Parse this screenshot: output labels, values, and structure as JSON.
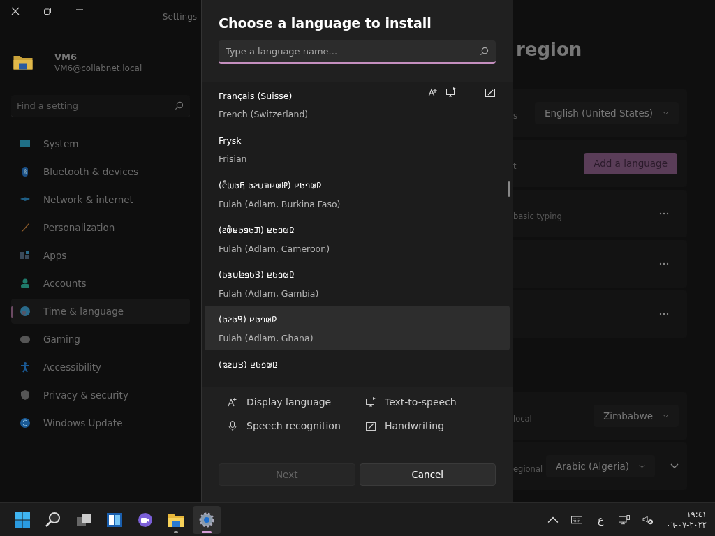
{
  "window": {
    "title": "Settings"
  },
  "account": {
    "name": "VM6",
    "email": "VM6@collabnet.local"
  },
  "sidebar": {
    "search": {
      "placeholder": "Find a setting"
    },
    "items": [
      {
        "label": "System",
        "kind": "system",
        "selected": false
      },
      {
        "label": "Bluetooth & devices",
        "kind": "bluetooth",
        "selected": false
      },
      {
        "label": "Network & internet",
        "kind": "network",
        "selected": false
      },
      {
        "label": "Personalization",
        "kind": "brush",
        "selected": false
      },
      {
        "label": "Apps",
        "kind": "apps",
        "selected": false
      },
      {
        "label": "Accounts",
        "kind": "person",
        "selected": false
      },
      {
        "label": "Time & language",
        "kind": "globe",
        "selected": true
      },
      {
        "label": "Gaming",
        "kind": "gamepad",
        "selected": false
      },
      {
        "label": "Accessibility",
        "kind": "accessibility",
        "selected": false
      },
      {
        "label": "Privacy & security",
        "kind": "shield",
        "selected": false
      },
      {
        "label": "Windows Update",
        "kind": "update",
        "selected": false
      }
    ]
  },
  "page": {
    "title": "region",
    "rows": [
      {
        "kind": "dropdown",
        "label": "s",
        "value": "English (United States)"
      },
      {
        "kind": "button",
        "label": "t",
        "value": "Add a language"
      },
      {
        "kind": "more",
        "label": "basic typing"
      },
      {
        "kind": "more"
      },
      {
        "kind": "more"
      },
      {
        "kind": "gap"
      },
      {
        "kind": "dropdown",
        "label": "local",
        "value": "Zimbabwe"
      },
      {
        "kind": "expander",
        "label": "egional",
        "value": "Arabic (Algeria)"
      }
    ]
  },
  "dialog": {
    "title": "Choose a language to install",
    "search": {
      "placeholder": "Type a language name..."
    },
    "languages": [
      {
        "native": "Français (Suisse)",
        "english": "French (Switzerland)",
        "hovered": false,
        "features": [
          {
            "kind": "display"
          },
          {
            "kind": "tts"
          },
          {
            "kind": "handwriting"
          }
        ]
      },
      {
        "native": "Frysk",
        "english": "Frisian",
        "hovered": false
      },
      {
        "native": "𞤆𞤵𞤤𞤢𞤪 (𞤄𞤵𞤪𞤳𞤭𞤲𞤢 𞤊𞤢𞤧𞤮𞥅)",
        "english": "Fulah (Adlam, Burkina Faso)",
        "hovered": false
      },
      {
        "native": "𞤆𞤵𞤤𞤢𞤪 (𞤑𞤢𞤥𞤢𞤪𞤵𞥅𞤲)",
        "english": "Fulah (Adlam, Cameroon)",
        "hovered": false
      },
      {
        "native": "𞤆𞤵𞤤𞤢𞤪 (𞤘𞤢𞤥𞤦𞤭𞤴𞤢)",
        "english": "Fulah (Adlam, Gambia)",
        "hovered": false
      },
      {
        "native": "𞤆𞤵𞤤𞤢𞤪 (𞤘𞤢𞤲𞤢)",
        "english": "Fulah (Adlam, Ghana)",
        "hovered": true
      },
      {
        "native": "𞤆𞤵𞤤𞤢𞤪 (𞤘𞤭𞤲𞤫)",
        "hovered": false
      }
    ],
    "legend": [
      {
        "kind": "display",
        "label": "Display language"
      },
      {
        "kind": "tts",
        "label": "Text-to-speech"
      },
      {
        "kind": "speech",
        "label": "Speech recognition"
      },
      {
        "kind": "handwriting",
        "label": "Handwriting"
      }
    ],
    "buttons": [
      {
        "label": "Next",
        "disabled": true
      },
      {
        "label": "Cancel",
        "disabled": false
      }
    ]
  },
  "taskbar": {
    "apps": [
      {
        "kind": "start",
        "active": false,
        "running": false
      },
      {
        "kind": "search",
        "active": false,
        "running": false
      },
      {
        "kind": "taskview",
        "active": false,
        "running": false
      },
      {
        "kind": "widgets",
        "active": false,
        "running": false
      },
      {
        "kind": "chat",
        "active": false,
        "running": false
      },
      {
        "kind": "explorer",
        "active": false,
        "running": true
      },
      {
        "kind": "settings",
        "active": true,
        "running": true
      }
    ],
    "tray": {
      "input": "ع",
      "time": "١٩:٤١",
      "date": "٢٠٢٢-٠٧-٠٦"
    }
  }
}
